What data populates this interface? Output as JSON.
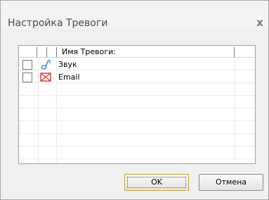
{
  "window": {
    "title": "Настройка Тревоги",
    "close_glyph": "x"
  },
  "grid": {
    "header": {
      "name_column": "Имя Тревоги:"
    },
    "rows": [
      {
        "label": "Звук",
        "icon": "sound-note-icon",
        "checked": false
      },
      {
        "label": "Email",
        "icon": "email-envelope-icon",
        "checked": false
      }
    ]
  },
  "buttons": {
    "ok": "OK",
    "cancel": "Отмена"
  },
  "colors": {
    "sound_icon": "#3a8ee6",
    "email_icon": "#e0302a",
    "ok_border": "#c9a227"
  }
}
